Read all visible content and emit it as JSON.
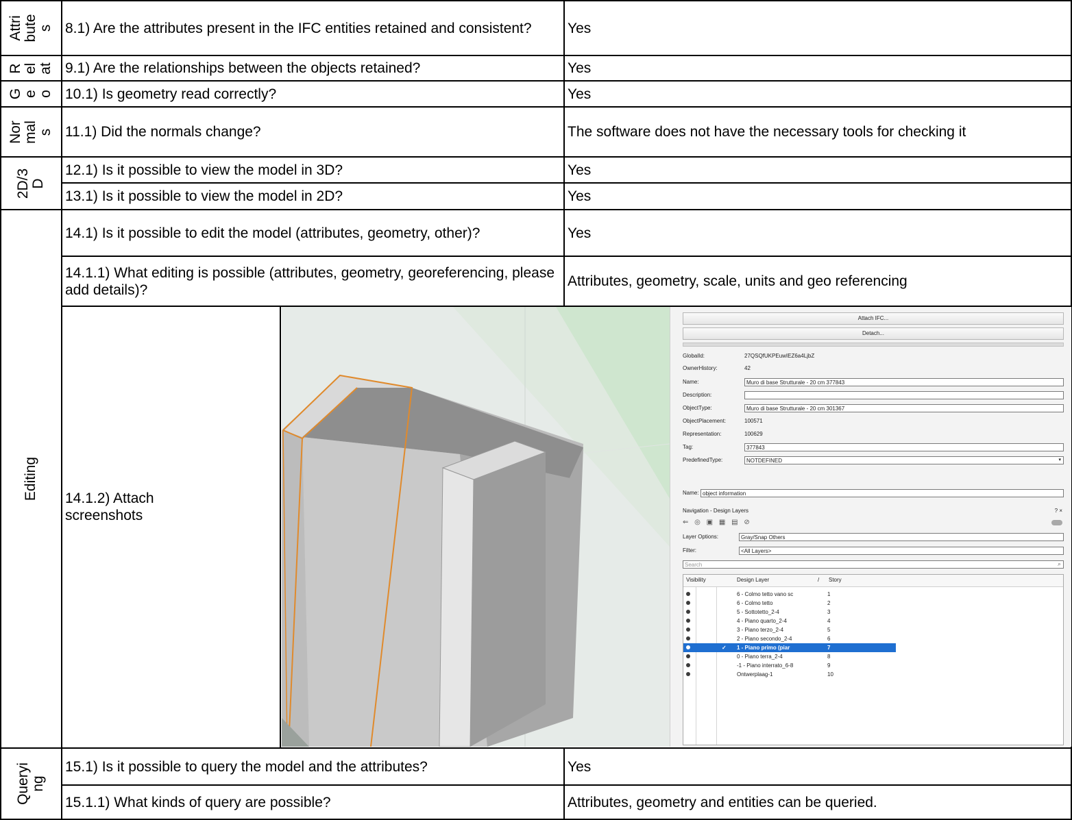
{
  "categories": {
    "attributes": "Attri\nbute\ns",
    "relationships": "R\nel\nat",
    "geometry": "G\ne\no",
    "normals": "Nor\nmal\ns",
    "view": "2D/3\nD",
    "editing": "Editing",
    "querying": "Queryi\nng"
  },
  "rows": [
    {
      "question": "8.1) Are the attributes present in the IFC entities retained and consistent?",
      "answer": "Yes"
    },
    {
      "question": "9.1) Are the relationships between the objects retained?",
      "answer": "Yes"
    },
    {
      "question": "10.1) Is geometry read correctly?",
      "answer": "Yes"
    },
    {
      "question": "11.1) Did the normals change?",
      "answer": "The software does not have the necessary tools for checking it"
    },
    {
      "question": "12.1) Is it possible to view the model in 3D?",
      "answer": "Yes"
    },
    {
      "question": "13.1) Is it possible to view the model in 2D?",
      "answer": "Yes"
    },
    {
      "question": "14.1) Is it possible to edit the model (attributes, geometry, other)?",
      "answer": "Yes"
    },
    {
      "question": "14.1.1) What editing is possible (attributes, geometry, georeferencing, please add details)?",
      "answer": "Attributes, geometry, scale, units and geo referencing"
    },
    {
      "question": "14.1.2) Attach screenshots"
    },
    {
      "question": "15.1) Is it possible to query the model and the attributes?",
      "answer": "Yes"
    },
    {
      "question": "15.1.1) What kinds of query are possible?",
      "answer": "Attributes, geometry and entities can be queried."
    }
  ],
  "screenshot": {
    "attach_button": "Attach IFC...",
    "detach_button": "Detach...",
    "props": [
      {
        "label": "GlobalId:",
        "value": "27QSQfUKPEuwIEZ6a4LjbZ"
      },
      {
        "label": "OwnerHistory:",
        "value": "42"
      },
      {
        "label": "Name:",
        "value": "Muro di base Strutturale - 20 cm 377843"
      },
      {
        "label": "Description:",
        "value": ""
      },
      {
        "label": "ObjectType:",
        "value": "Muro di base Strutturale - 20 cm 301367"
      },
      {
        "label": "ObjectPlacement:",
        "value": "100571"
      },
      {
        "label": "Representation:",
        "value": "100629"
      },
      {
        "label": "Tag:",
        "value": "377843"
      },
      {
        "label": "PredefinedType:",
        "value": "NOTDEFINED"
      }
    ],
    "name_label": "Name:",
    "name_value": "object information",
    "nav_title": "Navigation - Design Layers",
    "nav_controls": "? ×",
    "layer_options_label": "Layer Options:",
    "layer_options_value": "Gray/Snap Others",
    "filter_label": "Filter:",
    "filter_value": "<All Layers>",
    "search_placeholder": "Search",
    "columns": [
      "Visibility",
      "Design Layer",
      "/",
      "Story"
    ],
    "layers": [
      {
        "name": "6 - Colmo tetto vano sc",
        "story": "1"
      },
      {
        "name": "6 - Colmo tetto",
        "story": "2"
      },
      {
        "name": "5 - Sottotetto_2-4",
        "story": "3"
      },
      {
        "name": "4 - Piano quarto_2-4",
        "story": "4"
      },
      {
        "name": "3 - Piano terzo_2-4",
        "story": "5"
      },
      {
        "name": "2 - Piano secondo_2-4",
        "story": "6"
      },
      {
        "name": "1 - Piano primo (piar",
        "story": "7",
        "check": "✓"
      },
      {
        "name": "0 - Piano terra_2-4",
        "story": "8"
      },
      {
        "name": "-1 - Piano interrato_6-8",
        "story": "9"
      },
      {
        "name": "Ontwerplaag-1",
        "story": "10"
      }
    ]
  },
  "colors": {
    "selected_row": "#1f6fd1",
    "wall_highlight": "#e08a2c"
  }
}
